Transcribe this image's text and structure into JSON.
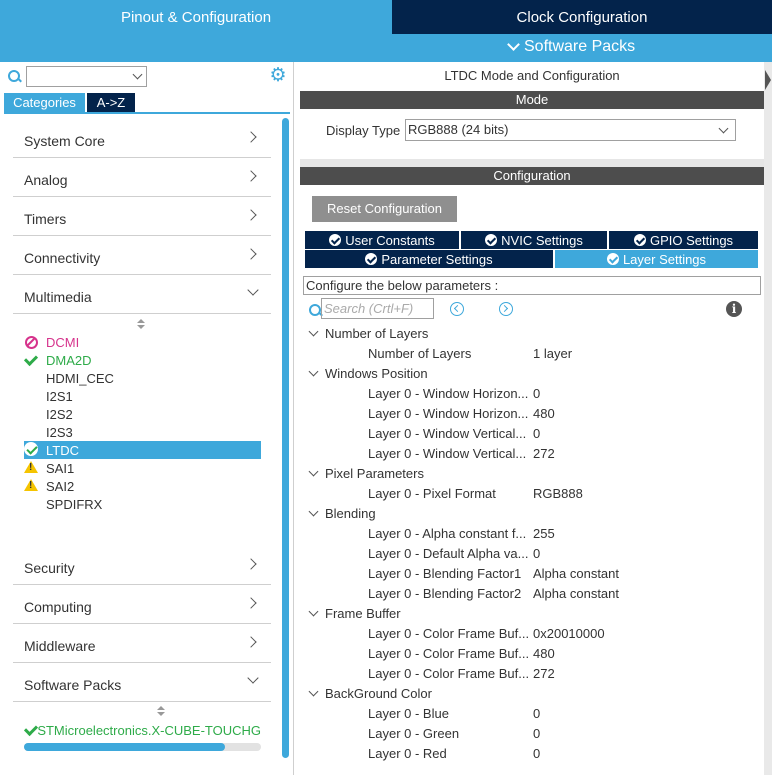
{
  "header": {
    "tab_pinout": "Pinout & Configuration",
    "tab_clock": "Clock Configuration",
    "software_packs": "Software Packs"
  },
  "left": {
    "search_value": "",
    "tab_categories": "Categories",
    "tab_az": "A->Z",
    "categories": {
      "system_core": "System Core",
      "analog": "Analog",
      "timers": "Timers",
      "connectivity": "Connectivity",
      "multimedia": "Multimedia",
      "security": "Security",
      "computing": "Computing",
      "middleware": "Middleware",
      "software_packs": "Software Packs"
    },
    "multimedia_items": [
      {
        "name": "DCMI",
        "status": "disabled"
      },
      {
        "name": "DMA2D",
        "status": "enabled"
      },
      {
        "name": "HDMI_CEC",
        "status": "none"
      },
      {
        "name": "I2S1",
        "status": "none"
      },
      {
        "name": "I2S2",
        "status": "none"
      },
      {
        "name": "I2S3",
        "status": "none"
      },
      {
        "name": "LTDC",
        "status": "selected"
      },
      {
        "name": "SAI1",
        "status": "warning"
      },
      {
        "name": "SAI2",
        "status": "warning"
      },
      {
        "name": "SPDIFRX",
        "status": "none"
      }
    ],
    "software_pack_item": "STMicroelectronics.X-CUBE-TOUCHG",
    "hscroll_fraction": 0.85
  },
  "right": {
    "title": "LTDC Mode and Configuration",
    "mode_header": "Mode",
    "display_type_label": "Display Type",
    "display_type_value": "RGB888 (24 bits)",
    "config_header": "Configuration",
    "reset_button": "Reset Configuration",
    "tabs": {
      "user_constants": "User Constants",
      "nvic": "NVIC Settings",
      "gpio": "GPIO Settings",
      "parameter": "Parameter Settings",
      "layer": "Layer Settings"
    },
    "param_header": "Configure the below parameters :",
    "search_placeholder": "Search (Crtl+F)",
    "groups": {
      "g1": "Number of Layers",
      "g2": "Windows Position",
      "g3": "Pixel Parameters",
      "g4": "Blending",
      "g5": "Frame Buffer",
      "g6": "BackGround Color"
    },
    "rows": [
      {
        "k": "Number of Layers",
        "v": "1 layer"
      },
      {
        "k": "Layer 0 - Window Horizon...",
        "v": "0"
      },
      {
        "k": "Layer 0 - Window Horizon...",
        "v": "480"
      },
      {
        "k": "Layer 0 - Window Vertical...",
        "v": "0"
      },
      {
        "k": "Layer 0 - Window Vertical...",
        "v": "272"
      },
      {
        "k": "Layer 0 - Pixel Format",
        "v": "RGB888"
      },
      {
        "k": "Layer 0 - Alpha constant f...",
        "v": "255"
      },
      {
        "k": "Layer 0 - Default Alpha va...",
        "v": "0"
      },
      {
        "k": "Layer 0 - Blending Factor1",
        "v": "Alpha constant"
      },
      {
        "k": "Layer 0 - Blending Factor2",
        "v": "Alpha constant"
      },
      {
        "k": "Layer 0 - Color Frame Buf...",
        "v": "0x20010000"
      },
      {
        "k": "Layer 0 - Color Frame Buf...",
        "v": "480"
      },
      {
        "k": "Layer 0 - Color Frame Buf...",
        "v": "272"
      },
      {
        "k": "Layer 0 - Blue",
        "v": "0"
      },
      {
        "k": "Layer 0 - Green",
        "v": "0"
      },
      {
        "k": "Layer 0 - Red",
        "v": "0"
      }
    ]
  },
  "colors": {
    "accent": "#3ea8db",
    "dark_navy": "#03234b",
    "section_header": "#4d4d4d",
    "enabled_green": "#2eab49",
    "disabled_pink": "#d6338c",
    "warning_yellow": "#f5c400"
  }
}
